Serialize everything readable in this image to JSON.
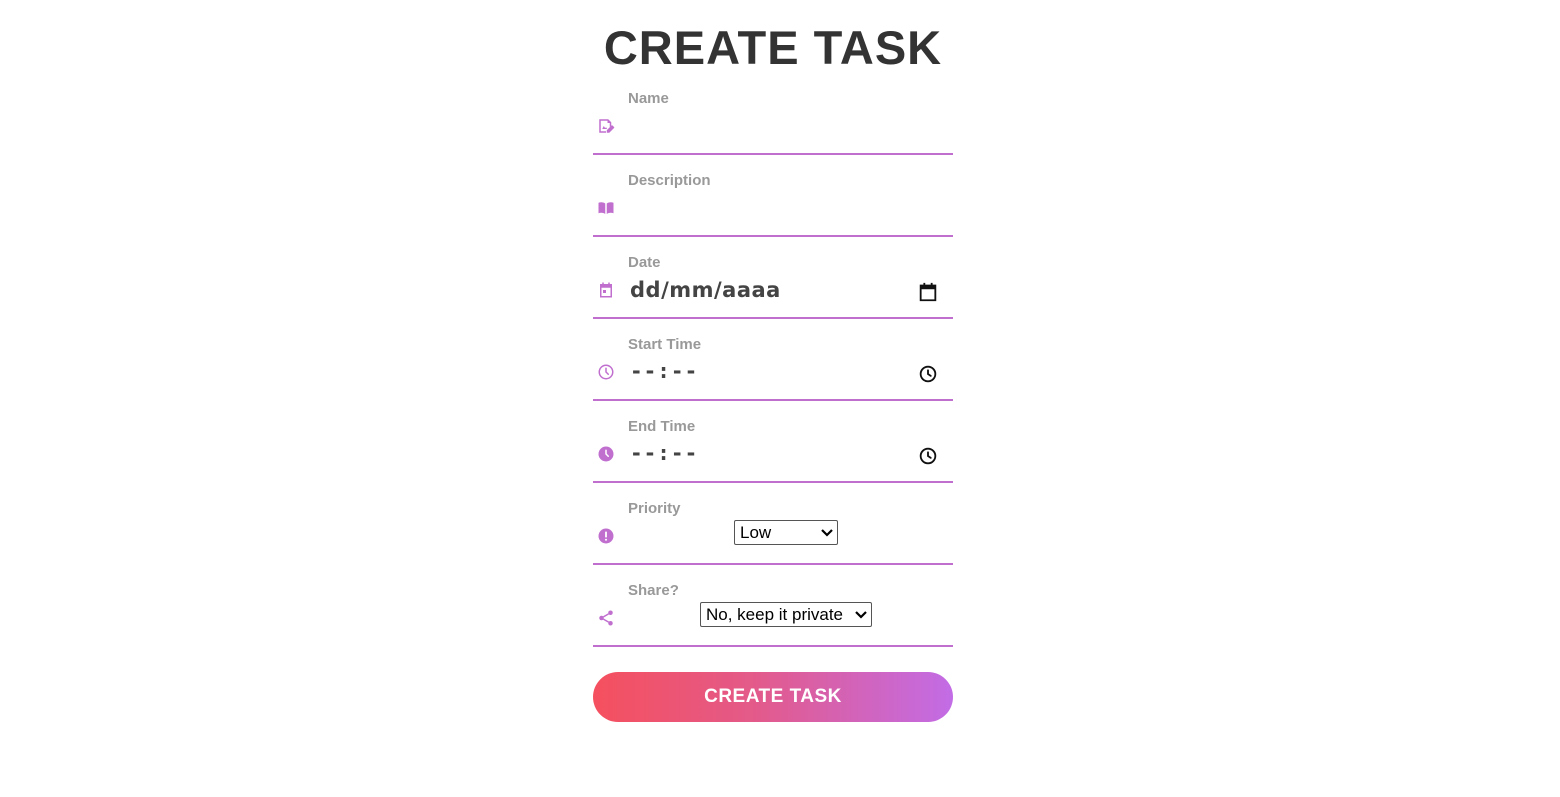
{
  "page": {
    "title": "CREATE TASK"
  },
  "form": {
    "name": {
      "label": "Name",
      "value": "",
      "icon": "edit-note-icon"
    },
    "description": {
      "label": "Description",
      "value": "",
      "icon": "book-icon"
    },
    "date": {
      "label": "Date",
      "placeholder": "dd/mm/aaaa",
      "icon": "calendar-icon"
    },
    "start_time": {
      "label": "Start Time",
      "placeholder": "--:--",
      "icon": "clock-outline-icon"
    },
    "end_time": {
      "label": "End Time",
      "placeholder": "--:--",
      "icon": "clock-filled-icon"
    },
    "priority": {
      "label": "Priority",
      "selected": "Low",
      "icon": "exclamation-circle-icon"
    },
    "share": {
      "label": "Share?",
      "selected": "No, keep it private",
      "icon": "share-icon"
    },
    "submit_label": "CREATE TASK"
  },
  "colors": {
    "accent": "#c06fcf",
    "title": "#333333",
    "label": "#999999",
    "button_gradient_start": "#f5505e",
    "button_gradient_end": "#c26ce6"
  }
}
